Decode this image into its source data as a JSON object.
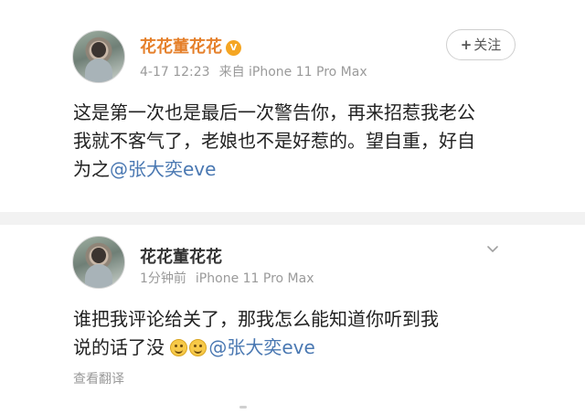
{
  "posts": [
    {
      "name": "花花董花花",
      "vip_badge": "V",
      "date": "4-17 12:23",
      "source": "来自 iPhone 11 Pro Max",
      "follow_label": "关注",
      "text_lines": [
        "这是第一次也是最后一次警告你，再来招惹我老公",
        "我就不客气了，老娘也不是好惹的。望自重，好自",
        "为之"
      ],
      "mention": "@张大奕eve"
    },
    {
      "name": "花花董花花",
      "time": "1分钟前",
      "device": "iPhone 11 Pro Max",
      "text_lines": [
        "谁把我评论给关了，那我怎么能知道你听到我",
        "说的话了没"
      ],
      "mention": "@张大奕eve",
      "translate_label": "查看翻译"
    }
  ],
  "colors": {
    "name_orange": "#e5802b",
    "link_blue": "#4a78b2",
    "meta_gray": "#9a9a9a",
    "divider_gray": "#f2f2f2"
  },
  "icons": {
    "follow": "plus-icon",
    "collapse": "chevron-down-icon",
    "badge": "vip-icon",
    "emoji": "smile-icon"
  }
}
